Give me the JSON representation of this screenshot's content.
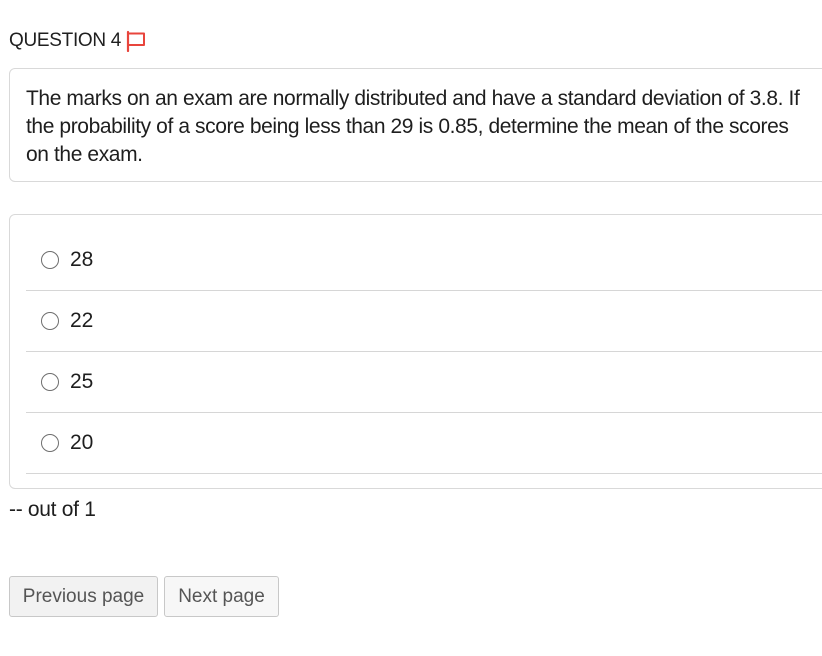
{
  "question": {
    "header": "QUESTION 4",
    "flag_icon": "flag-outline-icon",
    "flag_color": "#e8453c",
    "text": "The marks on an exam are normally distributed and have a standard deviation of 3.8. If the probability of a score being less than 29 is 0.85, determine the mean of the scores on the exam."
  },
  "answers": [
    {
      "label": "28"
    },
    {
      "label": "22"
    },
    {
      "label": "25"
    },
    {
      "label": "20"
    }
  ],
  "score_text": "-- out of 1",
  "navigation": {
    "previous_label": "Previous page",
    "next_label": "Next page"
  }
}
